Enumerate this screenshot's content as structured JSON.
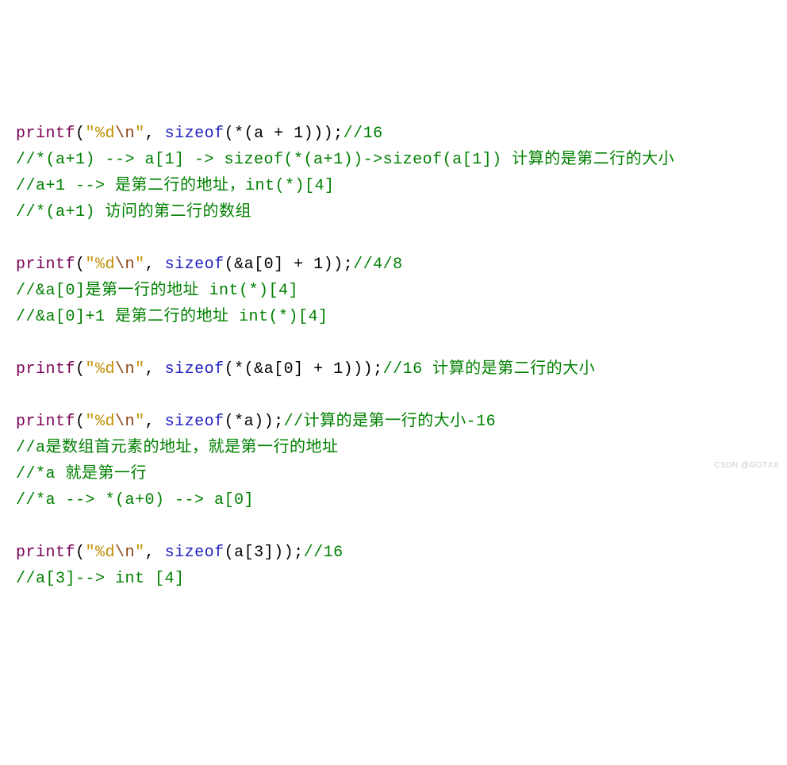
{
  "lines": [
    {
      "segments": [
        {
          "cls": "fn",
          "t": "printf"
        },
        {
          "cls": "punct",
          "t": "("
        },
        {
          "cls": "str",
          "t": "\"%d"
        },
        {
          "cls": "esc",
          "t": "\\n"
        },
        {
          "cls": "str",
          "t": "\""
        },
        {
          "cls": "punct",
          "t": ", "
        },
        {
          "cls": "kw",
          "t": "sizeof"
        },
        {
          "cls": "punct",
          "t": "(*(a + 1)));"
        },
        {
          "cls": "cmt",
          "t": "//16"
        }
      ]
    },
    {
      "segments": [
        {
          "cls": "cmt",
          "t": "//*(a+1) --> a[1] -> sizeof(*(a+1))->sizeof(a[1]) 计算的是第二行的大小"
        }
      ]
    },
    {
      "segments": [
        {
          "cls": "cmt",
          "t": "//a+1 --> 是第二行的地址，int(*)[4]"
        }
      ]
    },
    {
      "segments": [
        {
          "cls": "cmt",
          "t": "//*(a+1) 访问的第二行的数组"
        }
      ]
    },
    {
      "segments": [
        {
          "cls": "punct",
          "t": " "
        }
      ]
    },
    {
      "segments": [
        {
          "cls": "fn",
          "t": "printf"
        },
        {
          "cls": "punct",
          "t": "("
        },
        {
          "cls": "str",
          "t": "\"%d"
        },
        {
          "cls": "esc",
          "t": "\\n"
        },
        {
          "cls": "str",
          "t": "\""
        },
        {
          "cls": "punct",
          "t": ", "
        },
        {
          "cls": "kw",
          "t": "sizeof"
        },
        {
          "cls": "punct",
          "t": "(&a[0] + 1));"
        },
        {
          "cls": "cmt",
          "t": "//4/8"
        }
      ]
    },
    {
      "segments": [
        {
          "cls": "cmt",
          "t": "//&a[0]是第一行的地址 int(*)[4]"
        }
      ]
    },
    {
      "segments": [
        {
          "cls": "cmt",
          "t": "//&a[0]+1 是第二行的地址 int(*)[4]"
        }
      ]
    },
    {
      "segments": [
        {
          "cls": "punct",
          "t": " "
        }
      ]
    },
    {
      "segments": [
        {
          "cls": "fn",
          "t": "printf"
        },
        {
          "cls": "punct",
          "t": "("
        },
        {
          "cls": "str",
          "t": "\"%d"
        },
        {
          "cls": "esc",
          "t": "\\n"
        },
        {
          "cls": "str",
          "t": "\""
        },
        {
          "cls": "punct",
          "t": ", "
        },
        {
          "cls": "kw",
          "t": "sizeof"
        },
        {
          "cls": "punct",
          "t": "(*(&a[0] + 1)));"
        },
        {
          "cls": "cmt",
          "t": "//16 计算的是第二行的大小"
        }
      ]
    },
    {
      "segments": [
        {
          "cls": "punct",
          "t": " "
        }
      ]
    },
    {
      "segments": [
        {
          "cls": "fn",
          "t": "printf"
        },
        {
          "cls": "punct",
          "t": "("
        },
        {
          "cls": "str",
          "t": "\"%d"
        },
        {
          "cls": "esc",
          "t": "\\n"
        },
        {
          "cls": "str",
          "t": "\""
        },
        {
          "cls": "punct",
          "t": ", "
        },
        {
          "cls": "kw",
          "t": "sizeof"
        },
        {
          "cls": "punct",
          "t": "(*a));"
        },
        {
          "cls": "cmt",
          "t": "//计算的是第一行的大小-16"
        }
      ]
    },
    {
      "segments": [
        {
          "cls": "cmt",
          "t": "//a是数组首元素的地址，就是第一行的地址"
        }
      ]
    },
    {
      "segments": [
        {
          "cls": "cmt",
          "t": "//*a 就是第一行"
        }
      ]
    },
    {
      "segments": [
        {
          "cls": "cmt",
          "t": "//*a --> *(a+0) --> a[0]"
        }
      ]
    },
    {
      "segments": [
        {
          "cls": "punct",
          "t": " "
        }
      ]
    },
    {
      "segments": [
        {
          "cls": "fn",
          "t": "printf"
        },
        {
          "cls": "punct",
          "t": "("
        },
        {
          "cls": "str",
          "t": "\"%d"
        },
        {
          "cls": "esc",
          "t": "\\n"
        },
        {
          "cls": "str",
          "t": "\""
        },
        {
          "cls": "punct",
          "t": ", "
        },
        {
          "cls": "kw",
          "t": "sizeof"
        },
        {
          "cls": "punct",
          "t": "(a[3]));"
        },
        {
          "cls": "cmt",
          "t": "//16"
        }
      ]
    },
    {
      "segments": [
        {
          "cls": "cmt",
          "t": "//a[3]--> int [4]"
        }
      ]
    }
  ],
  "watermark": "CSDN @GOTXX"
}
